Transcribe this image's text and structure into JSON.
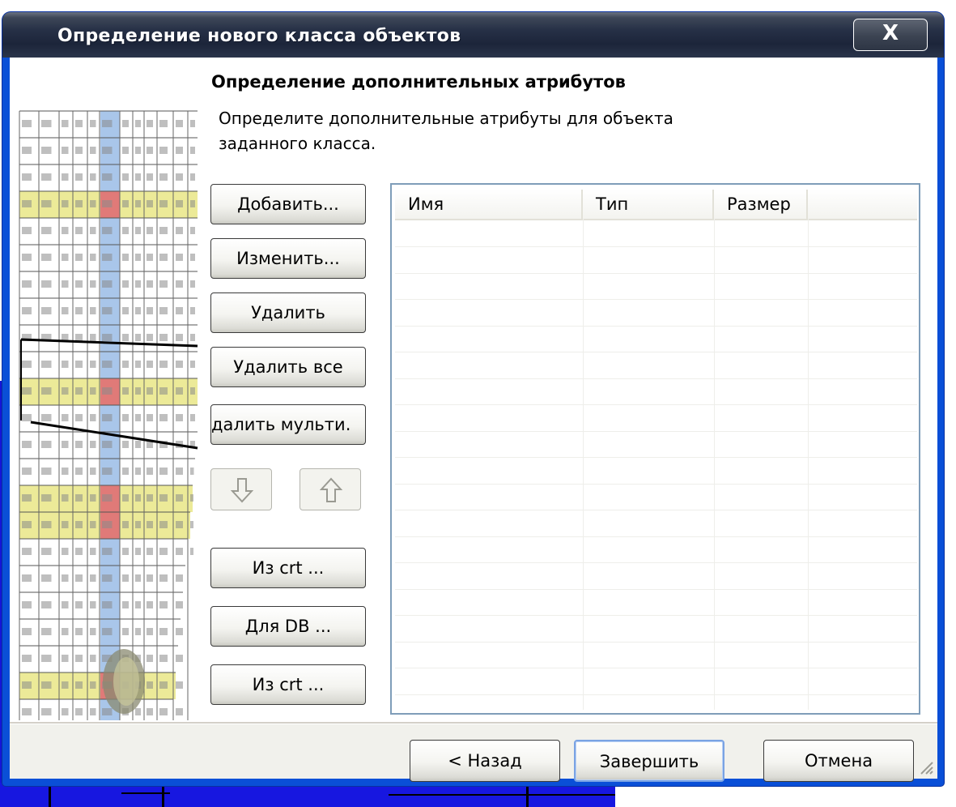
{
  "window": {
    "title": "Определение нового класса объектов",
    "close_glyph": "X"
  },
  "page": {
    "heading": "Определение дополнительных атрибутов",
    "description_line1": "Определите дополнительные атрибуты для объекта",
    "description_line2": "заданного класса."
  },
  "buttons": {
    "add": "Добавить...",
    "edit": "Изменить...",
    "delete": "Удалить",
    "delete_all": "Удалить все",
    "delete_multi": "далить мульти.",
    "from_crt_1": "Из crt ...",
    "for_db": "Для DB ...",
    "from_crt_2": "Из crt ..."
  },
  "list": {
    "columns": [
      "Имя",
      "Тип",
      "Размер"
    ],
    "rows": []
  },
  "footer": {
    "back": "< Назад",
    "finish": "Завершить",
    "cancel": "Отмена"
  },
  "icons": {
    "move_down": "arrow-down-icon",
    "move_up": "arrow-up-icon",
    "close": "close-icon",
    "resize": "resize-grip-icon"
  }
}
